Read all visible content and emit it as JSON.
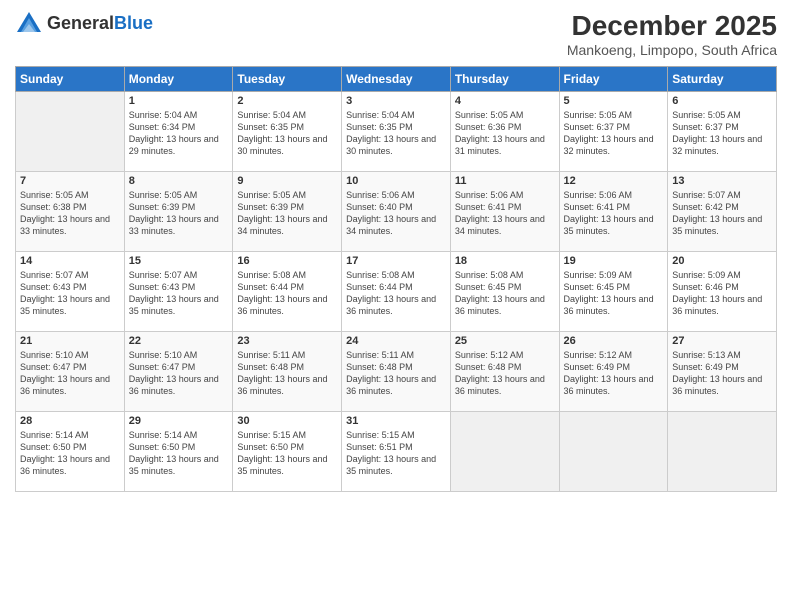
{
  "logo": {
    "general": "General",
    "blue": "Blue"
  },
  "title": {
    "month_year": "December 2025",
    "location": "Mankoeng, Limpopo, South Africa"
  },
  "days_header": [
    "Sunday",
    "Monday",
    "Tuesday",
    "Wednesday",
    "Thursday",
    "Friday",
    "Saturday"
  ],
  "weeks": [
    [
      {
        "num": "",
        "sunrise": "",
        "sunset": "",
        "daylight": ""
      },
      {
        "num": "1",
        "sunrise": "Sunrise: 5:04 AM",
        "sunset": "Sunset: 6:34 PM",
        "daylight": "Daylight: 13 hours and 29 minutes."
      },
      {
        "num": "2",
        "sunrise": "Sunrise: 5:04 AM",
        "sunset": "Sunset: 6:35 PM",
        "daylight": "Daylight: 13 hours and 30 minutes."
      },
      {
        "num": "3",
        "sunrise": "Sunrise: 5:04 AM",
        "sunset": "Sunset: 6:35 PM",
        "daylight": "Daylight: 13 hours and 30 minutes."
      },
      {
        "num": "4",
        "sunrise": "Sunrise: 5:05 AM",
        "sunset": "Sunset: 6:36 PM",
        "daylight": "Daylight: 13 hours and 31 minutes."
      },
      {
        "num": "5",
        "sunrise": "Sunrise: 5:05 AM",
        "sunset": "Sunset: 6:37 PM",
        "daylight": "Daylight: 13 hours and 32 minutes."
      },
      {
        "num": "6",
        "sunrise": "Sunrise: 5:05 AM",
        "sunset": "Sunset: 6:37 PM",
        "daylight": "Daylight: 13 hours and 32 minutes."
      }
    ],
    [
      {
        "num": "7",
        "sunrise": "Sunrise: 5:05 AM",
        "sunset": "Sunset: 6:38 PM",
        "daylight": "Daylight: 13 hours and 33 minutes."
      },
      {
        "num": "8",
        "sunrise": "Sunrise: 5:05 AM",
        "sunset": "Sunset: 6:39 PM",
        "daylight": "Daylight: 13 hours and 33 minutes."
      },
      {
        "num": "9",
        "sunrise": "Sunrise: 5:05 AM",
        "sunset": "Sunset: 6:39 PM",
        "daylight": "Daylight: 13 hours and 34 minutes."
      },
      {
        "num": "10",
        "sunrise": "Sunrise: 5:06 AM",
        "sunset": "Sunset: 6:40 PM",
        "daylight": "Daylight: 13 hours and 34 minutes."
      },
      {
        "num": "11",
        "sunrise": "Sunrise: 5:06 AM",
        "sunset": "Sunset: 6:41 PM",
        "daylight": "Daylight: 13 hours and 34 minutes."
      },
      {
        "num": "12",
        "sunrise": "Sunrise: 5:06 AM",
        "sunset": "Sunset: 6:41 PM",
        "daylight": "Daylight: 13 hours and 35 minutes."
      },
      {
        "num": "13",
        "sunrise": "Sunrise: 5:07 AM",
        "sunset": "Sunset: 6:42 PM",
        "daylight": "Daylight: 13 hours and 35 minutes."
      }
    ],
    [
      {
        "num": "14",
        "sunrise": "Sunrise: 5:07 AM",
        "sunset": "Sunset: 6:43 PM",
        "daylight": "Daylight: 13 hours and 35 minutes."
      },
      {
        "num": "15",
        "sunrise": "Sunrise: 5:07 AM",
        "sunset": "Sunset: 6:43 PM",
        "daylight": "Daylight: 13 hours and 35 minutes."
      },
      {
        "num": "16",
        "sunrise": "Sunrise: 5:08 AM",
        "sunset": "Sunset: 6:44 PM",
        "daylight": "Daylight: 13 hours and 36 minutes."
      },
      {
        "num": "17",
        "sunrise": "Sunrise: 5:08 AM",
        "sunset": "Sunset: 6:44 PM",
        "daylight": "Daylight: 13 hours and 36 minutes."
      },
      {
        "num": "18",
        "sunrise": "Sunrise: 5:08 AM",
        "sunset": "Sunset: 6:45 PM",
        "daylight": "Daylight: 13 hours and 36 minutes."
      },
      {
        "num": "19",
        "sunrise": "Sunrise: 5:09 AM",
        "sunset": "Sunset: 6:45 PM",
        "daylight": "Daylight: 13 hours and 36 minutes."
      },
      {
        "num": "20",
        "sunrise": "Sunrise: 5:09 AM",
        "sunset": "Sunset: 6:46 PM",
        "daylight": "Daylight: 13 hours and 36 minutes."
      }
    ],
    [
      {
        "num": "21",
        "sunrise": "Sunrise: 5:10 AM",
        "sunset": "Sunset: 6:47 PM",
        "daylight": "Daylight: 13 hours and 36 minutes."
      },
      {
        "num": "22",
        "sunrise": "Sunrise: 5:10 AM",
        "sunset": "Sunset: 6:47 PM",
        "daylight": "Daylight: 13 hours and 36 minutes."
      },
      {
        "num": "23",
        "sunrise": "Sunrise: 5:11 AM",
        "sunset": "Sunset: 6:48 PM",
        "daylight": "Daylight: 13 hours and 36 minutes."
      },
      {
        "num": "24",
        "sunrise": "Sunrise: 5:11 AM",
        "sunset": "Sunset: 6:48 PM",
        "daylight": "Daylight: 13 hours and 36 minutes."
      },
      {
        "num": "25",
        "sunrise": "Sunrise: 5:12 AM",
        "sunset": "Sunset: 6:48 PM",
        "daylight": "Daylight: 13 hours and 36 minutes."
      },
      {
        "num": "26",
        "sunrise": "Sunrise: 5:12 AM",
        "sunset": "Sunset: 6:49 PM",
        "daylight": "Daylight: 13 hours and 36 minutes."
      },
      {
        "num": "27",
        "sunrise": "Sunrise: 5:13 AM",
        "sunset": "Sunset: 6:49 PM",
        "daylight": "Daylight: 13 hours and 36 minutes."
      }
    ],
    [
      {
        "num": "28",
        "sunrise": "Sunrise: 5:14 AM",
        "sunset": "Sunset: 6:50 PM",
        "daylight": "Daylight: 13 hours and 36 minutes."
      },
      {
        "num": "29",
        "sunrise": "Sunrise: 5:14 AM",
        "sunset": "Sunset: 6:50 PM",
        "daylight": "Daylight: 13 hours and 35 minutes."
      },
      {
        "num": "30",
        "sunrise": "Sunrise: 5:15 AM",
        "sunset": "Sunset: 6:50 PM",
        "daylight": "Daylight: 13 hours and 35 minutes."
      },
      {
        "num": "31",
        "sunrise": "Sunrise: 5:15 AM",
        "sunset": "Sunset: 6:51 PM",
        "daylight": "Daylight: 13 hours and 35 minutes."
      },
      {
        "num": "",
        "sunrise": "",
        "sunset": "",
        "daylight": ""
      },
      {
        "num": "",
        "sunrise": "",
        "sunset": "",
        "daylight": ""
      },
      {
        "num": "",
        "sunrise": "",
        "sunset": "",
        "daylight": ""
      }
    ]
  ]
}
